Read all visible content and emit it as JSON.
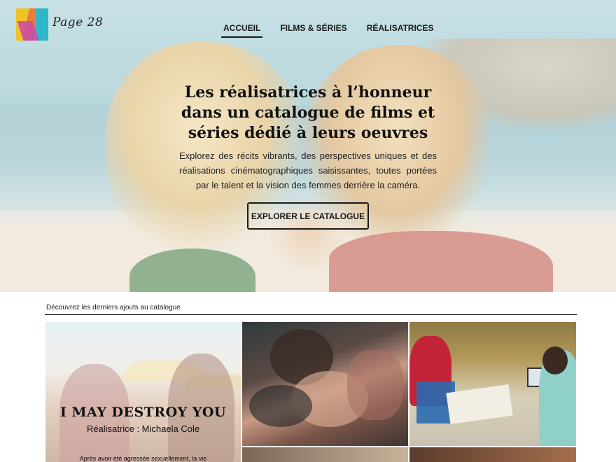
{
  "header": {
    "brand": "Page 28",
    "nav": [
      {
        "label": "ACCUEIL",
        "active": true
      },
      {
        "label": "FILMS & SÉRIES",
        "active": false
      },
      {
        "label": "RÉALISATRICES",
        "active": false
      }
    ]
  },
  "hero": {
    "title": "Les réalisatrices à l’honneur dans un catalogue de films et séries dédié à leurs oeuvres",
    "text": "Explorez des récits vibrants, des perspectives uniques et des réalisations cinématographiques saisissantes, toutes portées par le talent et la vision des femmes derrière la caméra.",
    "cta": "EXPLORER LE CATALOGUE"
  },
  "latest": {
    "label": "Découvrez les derniers ajouts au catalogue",
    "featured": {
      "title": "I MAY DESTROY YOU",
      "director": "Réalisatrice : Michaela Cole",
      "synopsis": "Après avoir été agressée sexuellement, la vie"
    }
  },
  "colors": {
    "text": "#1a1a1a",
    "background": "#ffffff"
  }
}
